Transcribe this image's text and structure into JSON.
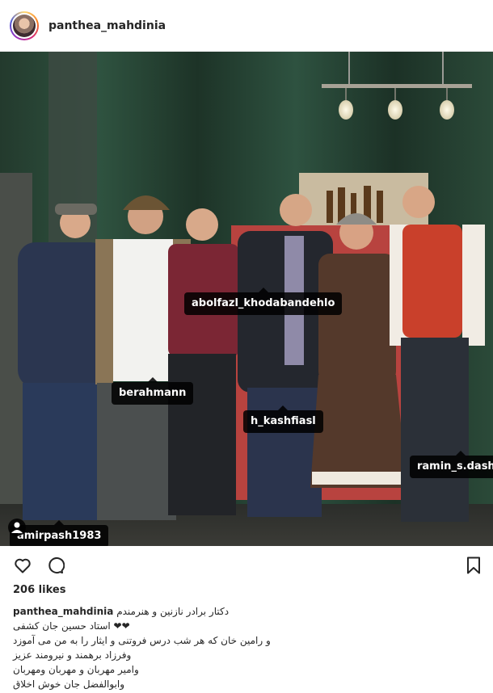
{
  "post": {
    "username": "panthea_mahdinia",
    "likes": "206 likes",
    "caption_user": "panthea_mahdinia",
    "caption_lines": [
      "دکتار برادر نازنین و هنرمندم",
      "❤❤ استاد حسین جان کشفی",
      "و رامین خان که هر شب درس فروتنی و ایثار را به من می آموزد",
      "وفرزاد برهمند و نیرومند عزیز",
      "وامیر مهربان و مهربان ومهربان",
      "وابوالفضل جان خوش اخلاق"
    ]
  },
  "tags": [
    "abolfazl_khodabandehlo",
    "berahmann",
    "h_kashfiasl",
    "ramin_s.dashti",
    "amirpash1983"
  ],
  "icons": {
    "like": "heart-icon",
    "comment": "comment-icon",
    "save": "bookmark-icon",
    "user_tags": "user-icon"
  }
}
